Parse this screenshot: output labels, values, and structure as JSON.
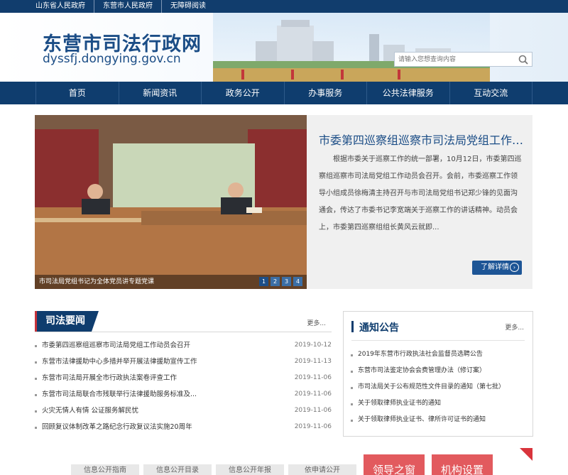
{
  "topbar": {
    "links": [
      "山东省人民政府",
      "东营市人民政府",
      "无障碍阅读"
    ]
  },
  "header": {
    "site_name": "东营市司法行政网",
    "domain": "dyssfj.dongying.gov.cn",
    "search_placeholder": "请输入您想查询内容",
    "search_icon": "magnifier-icon"
  },
  "nav": {
    "items": [
      "首页",
      "新闻资讯",
      "政务公开",
      "办事服务",
      "公共法律服务",
      "互动交流"
    ]
  },
  "feature": {
    "caption": "市司法局党组书记为全体党员讲专题党课",
    "pages": [
      "1",
      "2",
      "3",
      "4"
    ],
    "title": "市委第四巡察组巡察市司法局党组工作动员会召开",
    "body": "根据市委关于巡察工作的统一部署，10月12日，市委第四巡察组巡察市司法局党组工作动员会召开。会前，市委巡察工作领导小组成员徐梅清主持召开与市司法局党组书记郑少锋的见面沟通会，传达了市委书记李宽端关于巡察工作的讲话精神。动员会上，市委第四巡察组组长黄风云就即...",
    "more_label": "了解详情"
  },
  "news": {
    "title": "司法要闻",
    "more": "更多...",
    "items": [
      {
        "title": "市委第四巡察组巡察市司法局党组工作动员会召开",
        "date": "2019-10-12"
      },
      {
        "title": "东营市法律援助中心多措并举开展法律援助宣传工作",
        "date": "2019-11-13"
      },
      {
        "title": "东营市司法局开展全市行政执法案卷评查工作",
        "date": "2019-11-06"
      },
      {
        "title": "东营市司法局联合市残联举行法律援助服务标准及...",
        "date": "2019-11-06"
      },
      {
        "title": "火灾无情人有情 公证服务解民忧",
        "date": "2019-11-06"
      },
      {
        "title": "回顾复议体制改革之路纪念行政复议法实施20周年",
        "date": "2019-11-06"
      }
    ]
  },
  "notice": {
    "title": "通知公告",
    "more": "更多...",
    "items": [
      "2019年东营市行政执法社会监督员选聘公告",
      "东营市司法鉴定协会会费管理办法（修订案）",
      "市司法局关于公布规范性文件目录的通知（第七批）",
      "关于领取律师执业证书的通知",
      "关于领取律师执业证书、律所许可证书的通知"
    ]
  },
  "bottom": {
    "gray_buttons": [
      "信息公开指南",
      "信息公开目录",
      "信息公开年报",
      "依申请公开"
    ],
    "red_buttons": [
      "领导之窗",
      "机构设置"
    ]
  },
  "colors": {
    "primary": "#0f3d6e",
    "accent_red": "#e25a5e",
    "title_blue": "#1b4d86"
  }
}
